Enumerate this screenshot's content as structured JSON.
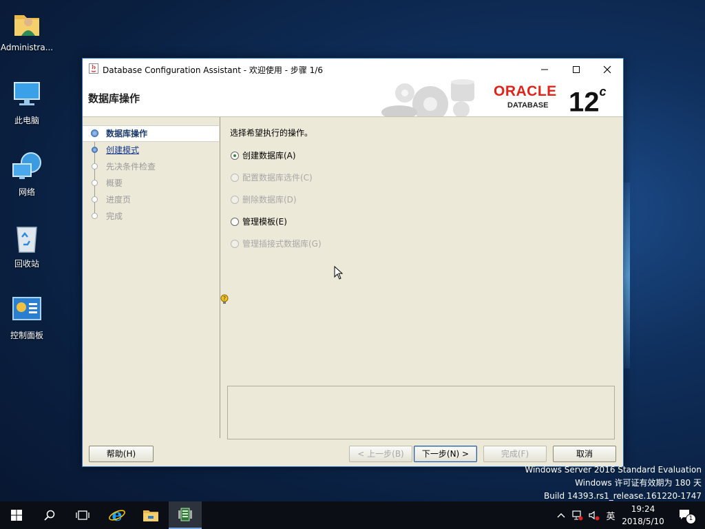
{
  "desktop": {
    "icons": [
      {
        "label": "Administra..."
      },
      {
        "label": "此电脑"
      },
      {
        "label": "网络"
      },
      {
        "label": "回收站"
      },
      {
        "label": "控制面板"
      }
    ]
  },
  "window": {
    "title": "Database Configuration Assistant - 欢迎使用 - 步骤 1/6",
    "page_title": "数据库操作",
    "logo": {
      "brand": "ORACLE",
      "product": "DATABASE",
      "version": "12",
      "version_suffix": "c"
    }
  },
  "steps": [
    {
      "label": "数据库操作",
      "state": "current"
    },
    {
      "label": "创建模式",
      "state": "next"
    },
    {
      "label": "先决条件检查",
      "state": "pending"
    },
    {
      "label": "概要",
      "state": "pending"
    },
    {
      "label": "进度页",
      "state": "pending"
    },
    {
      "label": "完成",
      "state": "pending"
    }
  ],
  "content": {
    "instruction": "选择希望执行的操作。",
    "options": [
      {
        "label": "创建数据库(A)",
        "checked": true,
        "enabled": true
      },
      {
        "label": "配置数据库选件(C)",
        "checked": false,
        "enabled": false
      },
      {
        "label": "删除数据库(D)",
        "checked": false,
        "enabled": false
      },
      {
        "label": "管理模板(E)",
        "checked": false,
        "enabled": true
      },
      {
        "label": "管理插接式数据库(G)",
        "checked": false,
        "enabled": false
      }
    ]
  },
  "buttons": {
    "help": "帮助(H)",
    "back": "< 上一步(B)",
    "next": "下一步(N) >",
    "finish": "完成(F)",
    "cancel": "取消"
  },
  "watermark": {
    "line1": "Windows Server 2016 Standard Evaluation",
    "line2": "Windows 许可证有效期为 180 天",
    "line3": "Build 14393.rs1_release.161220-1747"
  },
  "taskbar": {
    "ime": "英",
    "time": "19:24",
    "date": "2018/5/10",
    "notification_count": "1"
  },
  "colors": {
    "oracle_red": "#e2231a",
    "dialog_bg": "#ece9d8",
    "taskbar_bg": "#0b0f15"
  }
}
